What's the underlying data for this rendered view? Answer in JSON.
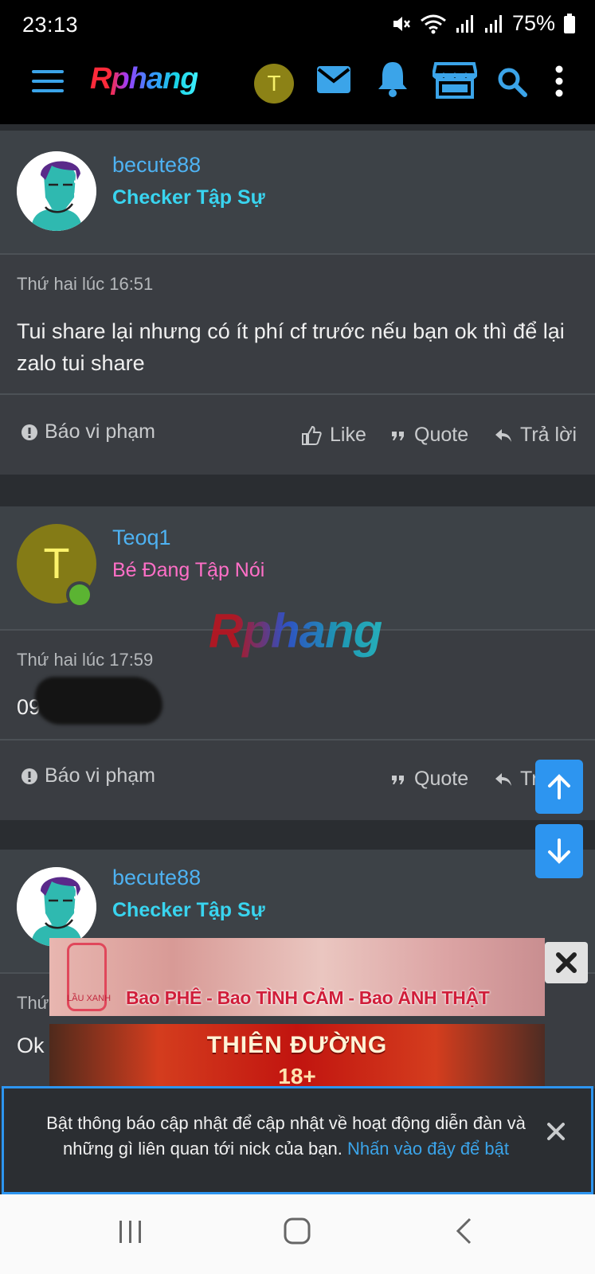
{
  "status_bar": {
    "time": "23:13",
    "battery": "75%"
  },
  "header": {
    "logo": "Rphang",
    "avatar_letter": "T"
  },
  "watermark": "Rphang",
  "posts": [
    {
      "username": "becute88",
      "user_title": "Checker Tập Sự",
      "date": "Thứ hai lúc 16:51",
      "message": "Tui share lại nhưng có ít phí cf trước nếu bạn ok thì để lại zalo tui share",
      "actions": {
        "report": "Báo vi phạm",
        "like": "Like",
        "quote": "Quote",
        "reply": "Trả lời"
      }
    },
    {
      "username": "Teoq1",
      "avatar_letter": "T",
      "user_title": "Bé Đang Tập Nói",
      "date": "Thứ hai lúc 17:59",
      "message": "09",
      "actions": {
        "report": "Báo vi phạm",
        "quote": "Quote",
        "reply": "Tr"
      }
    },
    {
      "username": "becute88",
      "user_title": "Checker Tập Sự",
      "date": "Thứ",
      "message": "Ok"
    }
  ],
  "ads": {
    "ad1_logo_text": "LẦU XANH",
    "ad1_caption": "Bao PHÊ - Bao TÌNH CẢM - Bao ẢNH THẬT",
    "ad2_title": "THIÊN ĐƯỜNG",
    "ad2_sub": "18+"
  },
  "notification": {
    "text": "Bật thông báo cập nhật để cập nhật về hoạt động diễn đàn và những gì liên quan tới nick của bạn.",
    "link": "Nhấn vào đây để bật"
  },
  "colors": {
    "accent": "#2d95f0",
    "username": "#4eb2f2",
    "title_cyan": "#39d4ef",
    "title_pink": "#ff6fc7"
  }
}
